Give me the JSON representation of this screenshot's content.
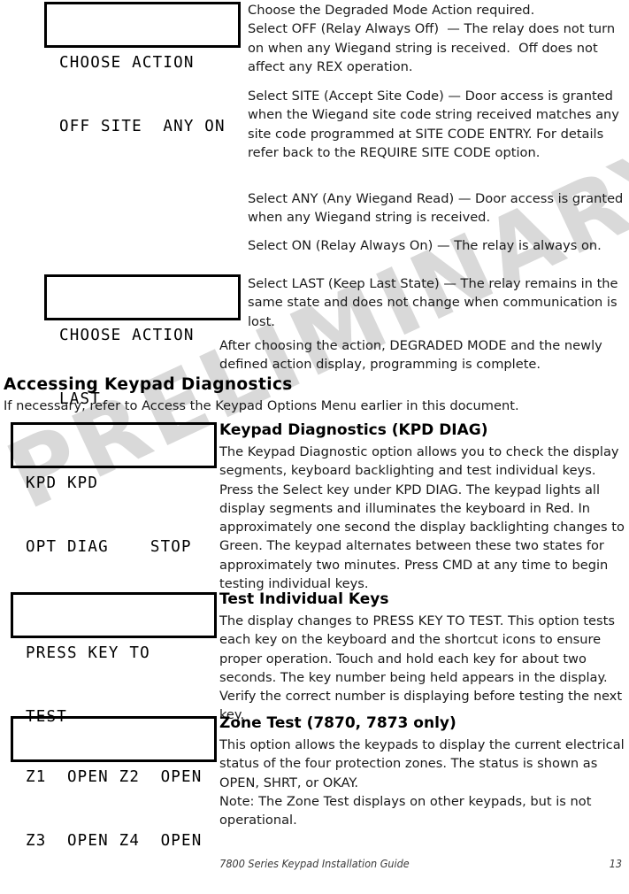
{
  "document": {
    "footer_title": "7800 Series Keypad Installation Guide",
    "page_number": "13"
  },
  "watermark": {
    "text": "PRELIMINARY",
    "color": "#d9d9d9"
  },
  "lcd_displays": [
    {
      "id": "choose-action-options",
      "line1": "CHOOSE ACTION",
      "line2": "OFF SITE  ANY ON"
    },
    {
      "id": "choose-action-last",
      "line1": "CHOOSE ACTION",
      "line2": "LAST"
    },
    {
      "id": "kpd-diag",
      "line1": "KPD KPD",
      "line2": "OPT DIAG    STOP"
    },
    {
      "id": "press-key-to-test",
      "line1": "PRESS KEY TO",
      "line2": "TEST"
    },
    {
      "id": "zone-test",
      "line1": "Z1  OPEN Z2  OPEN",
      "line2": "Z3  OPEN Z4  OPEN"
    }
  ],
  "body": {
    "p_choose_off": "Choose the Degraded Mode Action required.\nSelect OFF (Relay Always Off)  — The relay does not turn on when any Wiegand string is received.  Off does not affect any REX operation.",
    "p_site": "Select SITE (Accept Site Code) — Door access is granted when the Wiegand site code string received matches any site code programmed at SITE CODE ENTRY.  For details refer back to the REQUIRE SITE CODE option.",
    "p_any": "Select ANY (Any Wiegand Read) — Door access is granted when any Wiegand string is received.",
    "p_on": "Select ON (Relay Always On) — The relay is always on.",
    "p_last": "Select LAST (Keep Last State) — The relay remains in the same state and does not change when communication is lost.",
    "p_after": "After choosing the action, DEGRADED MODE and the newly defined action display, programming is complete.",
    "h_accessing": "Accessing Keypad Diagnostics",
    "p_accessing": "If necessary, refer to Access the Keypad Options Menu earlier in this document.",
    "h_kpd_diag": "Keypad Diagnostics (KPD DIAG)",
    "p_kpd_diag": "The Keypad Diagnostic option allows you to check the display segments, keyboard backlighting and test individual keys.  Press the Select key under KPD DIAG.  The keypad lights all display segments and illuminates the keyboard in Red.  In approximately one second the display backlighting changes to Green.  The keypad alternates between these two states for approximately two minutes.  Press CMD at any time to begin testing individual keys.",
    "h_test_keys": "Test Individual Keys",
    "p_test_keys": "The display changes to PRESS KEY TO TEST.  This option tests each key on the keyboard and the shortcut icons to ensure proper operation.  Touch and hold each key for about two seconds.  The key number being held appears in the display.  Verify the correct number is displaying before testing the next key.",
    "h_zone_test": "Zone Test  (7870, 7873 only)",
    "p_zone_test": "This option allows the keypads to display the current electrical status of the four protection zones.  The status is shown as OPEN, SHRT, or OKAY.",
    "p_zone_note": "Note: The Zone Test displays on other keypads, but is not operational."
  }
}
